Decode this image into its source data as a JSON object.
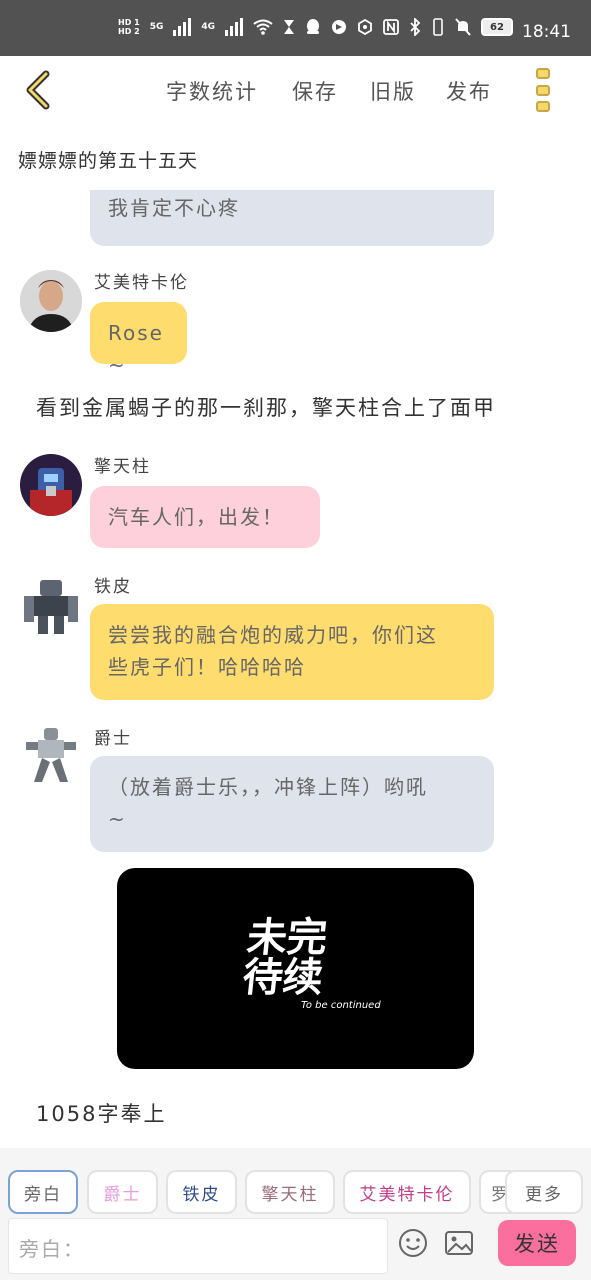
{
  "status_bar": {
    "hd1": "HD 1",
    "hd2": "HD 2",
    "net1": "5G",
    "net2": "4G",
    "battery": "62",
    "time": "18:41"
  },
  "toolbar": {
    "word_count": "字数统计",
    "save": "保存",
    "old_version": "旧版",
    "publish": "发布"
  },
  "story_title": "嫖嫖嫖的第五十五天",
  "messages": {
    "partial_bubble": "我肯定不心疼",
    "msg1_name": "艾美特卡伦",
    "msg1_text": "Rose ~",
    "narration1": "看到金属蝎子的那一刹那，擎天柱合上了面甲",
    "msg2_name": "擎天柱",
    "msg2_text": "汽车人们，出发！",
    "msg3_name": "铁皮",
    "msg3_line1": "尝尝我的融合炮的威力吧，你们这",
    "msg3_line2": "些虎子们！哈哈哈哈",
    "msg4_name": "爵士",
    "msg4_line1": "（放着爵士乐，，冲锋上阵）哟吼",
    "msg4_line2": "~",
    "image_text_big1": "未完",
    "image_text_big2": "待续",
    "image_text_small": "To be continued",
    "narration2": "1058字奉上"
  },
  "roles": {
    "narrator": "旁白",
    "jazz": "爵士",
    "ironhide": "铁皮",
    "optimus": "擎天柱",
    "emmett": "艾美特卡伦",
    "cut": "罗",
    "more": "更多"
  },
  "input": {
    "placeholder": "旁白：",
    "send": "发送"
  },
  "colors": {
    "status_bar": "#525252",
    "bubble_gray": "#dfe4ec",
    "bubble_yellow": "#fedc6e",
    "bubble_pink": "#fdd0dc",
    "send_button": "#fb6f9f",
    "narrator_chip_border": "#7ea0d8",
    "jazz_chip_text": "#e79be0",
    "ironhide_chip_text": "#2f4e8f",
    "optimus_chip_text": "#9b6b7a",
    "emmett_chip_text": "#c23c8a"
  }
}
